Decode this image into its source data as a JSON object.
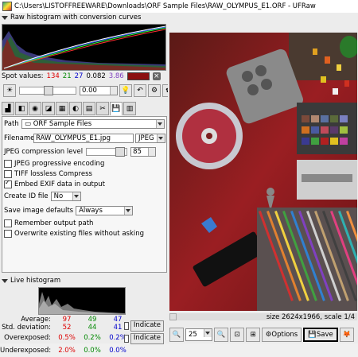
{
  "window": {
    "title": "C:\\Users\\LISTOFFREEWARE\\Downloads\\ORF Sample Files\\RAW_OLYMPUS_E1.ORF - UFRaw"
  },
  "raw_histogram": {
    "header": "Raw histogram with conversion curves"
  },
  "spot_values": {
    "label": "Spot values:",
    "r": "134",
    "g": "21",
    "b": "27",
    "l": "0.082",
    "m": "3.86",
    "swatch_color": "#8b1010"
  },
  "exposure": {
    "value": "0.00"
  },
  "output": {
    "path_label": "Path",
    "path_value": "ORF Sample Files",
    "filename_label": "Filename",
    "filename_value": "RAW_OLYMPUS_E1.jpg",
    "format_value": "JPEG",
    "compression_label": "JPEG compression level",
    "compression_value": "85",
    "jpeg_progressive": "JPEG progressive encoding",
    "tiff_lossless": "TIFF lossless Compress",
    "embed_exif": "Embed EXIF data in output",
    "create_id_label": "Create ID file",
    "create_id_value": "No",
    "save_defaults_label": "Save image defaults",
    "save_defaults_value": "Always",
    "remember_path": "Remember output path",
    "overwrite": "Overwrite existing files without asking"
  },
  "live_histogram": {
    "header": "Live histogram",
    "average_label": "Average:",
    "std_label": "Std. deviation:",
    "over_label": "Overexposed:",
    "under_label": "Underexposed:",
    "average": [
      "97",
      "49",
      "47"
    ],
    "std": [
      "52",
      "44",
      "41"
    ],
    "over": [
      "0.5%",
      "0.2%",
      "0.2%"
    ],
    "under": [
      "2.0%",
      "0.0%",
      "0.0%"
    ],
    "indicate": "Indicate"
  },
  "preview": {
    "size_info": "size 2624x1966, scale 1/4"
  },
  "toolbar": {
    "zoom_value": "25",
    "options_label": "Options",
    "save_label": "Save"
  }
}
